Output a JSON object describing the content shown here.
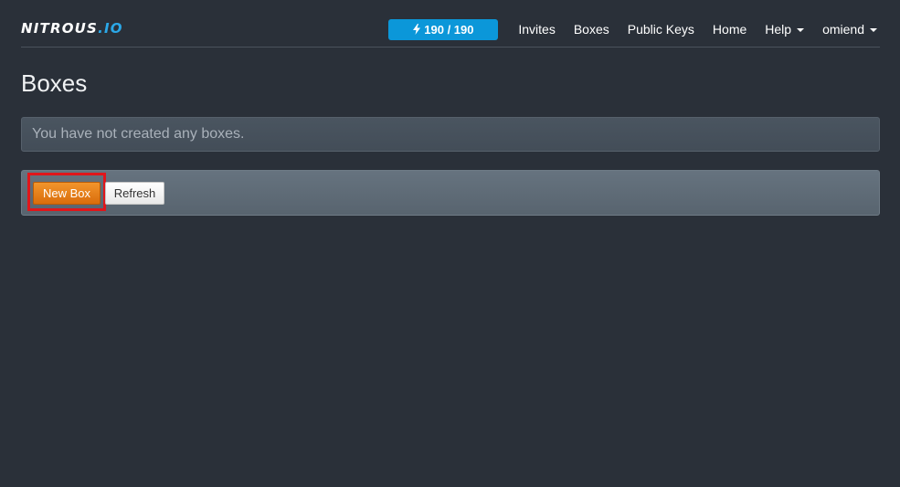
{
  "brand": {
    "name_main": "NITROUS",
    "name_dot": ".",
    "name_tld": "IO"
  },
  "nav": {
    "energy_badge": "190 / 190",
    "energy_icon": "bolt-icon",
    "links": {
      "invites": "Invites",
      "boxes": "Boxes",
      "public_keys": "Public Keys",
      "home": "Home",
      "help": "Help",
      "user": "omiend"
    }
  },
  "main": {
    "title": "Boxes",
    "empty_message": "You have not created any boxes.",
    "buttons": {
      "new_box": "New Box",
      "refresh": "Refresh"
    }
  },
  "colors": {
    "background": "#2a3039",
    "accent_blue": "#0b97d9",
    "new_box_orange": "#f08a1c",
    "highlight_red": "#e0161b"
  }
}
